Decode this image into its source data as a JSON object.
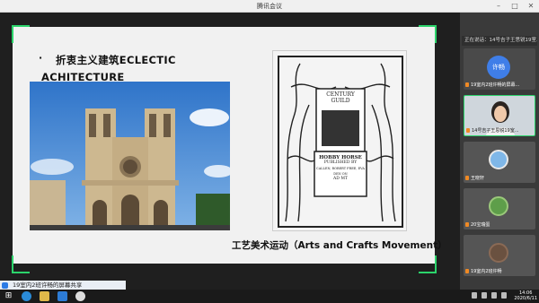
{
  "window": {
    "title": "腾讯会议"
  },
  "slide": {
    "bullet": "·",
    "title_line1": "折衷主义建筑ECLECTIC",
    "title_line2": "ACHITECTURE",
    "caption": "工艺美术运动（Arts and Crafts Movement）",
    "poster_text": [
      "CENTURY",
      "GUILD",
      "HOBBY HORSE",
      "PUBLISHED BY",
      "CALLEN, ROBERT FREE, EVA DEN ON",
      "AD MT"
    ]
  },
  "share_status": "19室内2班许畅的屏幕共享",
  "panel": {
    "banner": "正在说话：14号吉子王思锐19室...",
    "tiles": [
      {
        "name": "19室内2班许畅的屏幕...",
        "avatar": "许畅"
      },
      {
        "name": "14号吉子王思锐19室..."
      },
      {
        "name": "王晓轩"
      },
      {
        "name": "20宝瑞蛋"
      },
      {
        "name": "19室内2班许畅"
      }
    ]
  },
  "taskbar": {
    "time": "14:06",
    "date": "2020/6/11"
  },
  "colors": {
    "accent_green": "#2bd46b",
    "avatar_blue": "#3f7ee8",
    "mic_orange": "#f08a24"
  }
}
